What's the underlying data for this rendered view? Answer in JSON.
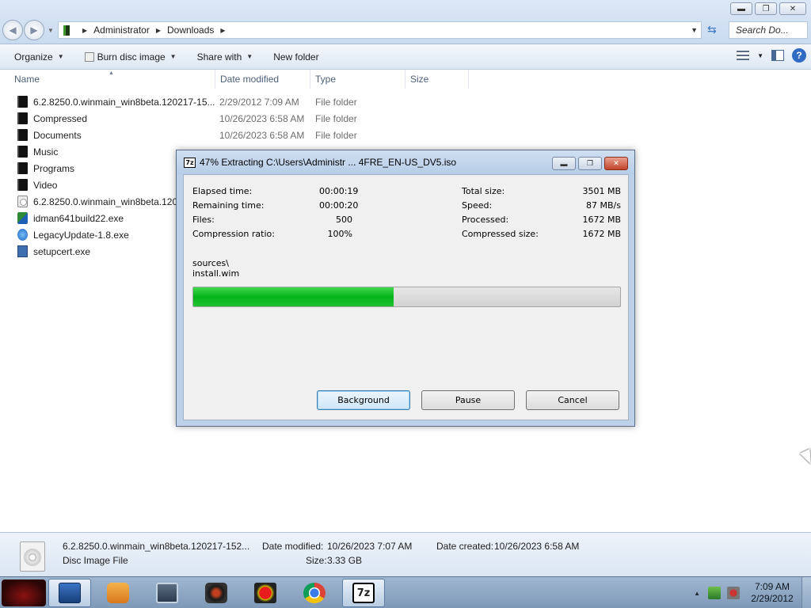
{
  "window": {
    "controls": {
      "minimize": "▬",
      "maximize": "❐",
      "close": "✕"
    }
  },
  "addressbar": {
    "crumbs": [
      "Administrator",
      "Downloads"
    ],
    "search_placeholder": "Search Do..."
  },
  "toolbar": {
    "organize": "Organize",
    "burn": "Burn disc image",
    "share": "Share with",
    "new_folder": "New folder"
  },
  "columns": {
    "name": "Name",
    "date": "Date modified",
    "type": "Type",
    "size": "Size"
  },
  "files": [
    {
      "name": "6.2.8250.0.winmain_win8beta.120217-15...",
      "date": "2/29/2012 7:09 AM",
      "type": "File folder",
      "icon": "folder-icon"
    },
    {
      "name": "Compressed",
      "date": "10/26/2023 6:58 AM",
      "type": "File folder",
      "icon": "folder-icon"
    },
    {
      "name": "Documents",
      "date": "10/26/2023 6:58 AM",
      "type": "File folder",
      "icon": "folder-icon"
    },
    {
      "name": "Music",
      "date": "",
      "type": "",
      "icon": "folder-icon"
    },
    {
      "name": "Programs",
      "date": "",
      "type": "",
      "icon": "folder-icon"
    },
    {
      "name": "Video",
      "date": "",
      "type": "",
      "icon": "folder-icon"
    },
    {
      "name": "6.2.8250.0.winmain_win8beta.1202",
      "date": "",
      "type": "",
      "icon": "disc-image-icon"
    },
    {
      "name": "idman641build22.exe",
      "date": "",
      "type": "",
      "icon": "idm-installer-icon"
    },
    {
      "name": "LegacyUpdate-1.8.exe",
      "date": "",
      "type": "",
      "icon": "legacy-update-icon"
    },
    {
      "name": "setupcert.exe",
      "date": "",
      "type": "",
      "icon": "setup-exe-icon"
    }
  ],
  "dialog": {
    "title": "47% Extracting C:\\Users\\Administr ... 4FRE_EN-US_DV5.iso",
    "left_stats": [
      {
        "label": "Elapsed time:",
        "value": "00:00:19"
      },
      {
        "label": "Remaining time:",
        "value": "00:00:20"
      },
      {
        "label": "Files:",
        "value": "500"
      },
      {
        "label": "Compression ratio:",
        "value": "100%"
      }
    ],
    "right_stats": [
      {
        "label": "Total size:",
        "value": "3501 MB"
      },
      {
        "label": "Speed:",
        "value": "87 MB/s"
      },
      {
        "label": "Processed:",
        "value": "1672 MB"
      },
      {
        "label": "Compressed size:",
        "value": "1672 MB"
      }
    ],
    "current_path": "sources\\",
    "current_file": "install.wim",
    "progress_percent": 47,
    "buttons": {
      "background": "Background",
      "pause": "Pause",
      "cancel": "Cancel"
    }
  },
  "details": {
    "filename": "6.2.8250.0.winmain_win8beta.120217-152...",
    "filetype": "Disc Image File",
    "date_modified_label": "Date modified:",
    "date_modified": "10/26/2023 7:07 AM",
    "date_created_label": "Date created:",
    "date_created": "10/26/2023 6:58 AM",
    "size_label": "Size:",
    "size": "3.33 GB"
  },
  "taskbar": {
    "apps": [
      "start-orb",
      "explorer",
      "media-player",
      "remote-desktop",
      "camera-app",
      "record-app",
      "chrome",
      "7zip"
    ],
    "clock_time": "7:09 AM",
    "clock_date": "2/29/2012"
  },
  "colors": {
    "progress_fill": "#06b21a",
    "titlebar": "#c9dbef",
    "dialog_frame": "#bcd0e8"
  }
}
